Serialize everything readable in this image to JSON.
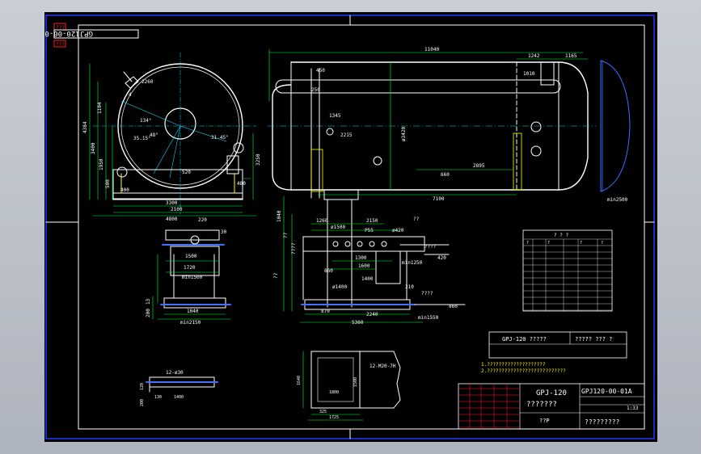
{
  "drawing": {
    "title_block": {
      "drawing_number": "GPJ120-00-01A",
      "model": "GPJ-120",
      "name": "???????",
      "scale": "1:33",
      "sub_label": "??P",
      "company": "?????????"
    },
    "side_tag": "GPJ120-00-01A",
    "red_tag_top": "???",
    "red_tag_bottom": "???",
    "spec_box": {
      "model": "GPJ-120 ?????",
      "code": "????? ??? ?"
    },
    "notes": [
      "1.????????????????????",
      "2.???????????????????????????"
    ],
    "table_header": "? ? ?",
    "table_col_headers": [
      "?",
      "?",
      "?",
      "?"
    ],
    "front_view": {
      "dims": [
        "2260",
        "4",
        "1104",
        "3400",
        "4384",
        "1950",
        "500",
        "520",
        "3300",
        "400",
        "3250",
        "480",
        "2100",
        "4800",
        "220",
        "30"
      ],
      "angles": [
        "134°",
        "48°",
        "35.15°",
        "31.45°"
      ]
    },
    "main_view": {
      "dims": [
        "11040",
        "1242",
        "1165",
        "450",
        "250",
        "1345",
        "2215",
        "1010",
        "2895",
        "660",
        "7100",
        "ø3420",
        "min2500"
      ]
    },
    "support_view": {
      "dims": [
        "1500",
        "1720",
        "min1500",
        "1040",
        "min2150",
        "200",
        "13"
      ]
    },
    "piping_view": {
      "dims": [
        "1040",
        "2150",
        "1260",
        "ø1500",
        "P55",
        "ø420",
        "min1250",
        "1300",
        "1600",
        "860",
        "ø1400",
        "1400",
        "210",
        "870",
        "2240",
        "5360",
        "min1550",
        "420",
        "860"
      ],
      "labels": [
        "??",
        "??",
        "????",
        "??",
        "????",
        "????"
      ]
    },
    "detail_a": {
      "label": "12-ø30",
      "dims": [
        "120",
        "130",
        "200",
        "1400"
      ]
    },
    "detail_b": {
      "label": "12-M20-7H",
      "dims": [
        "1640",
        "1500",
        "1800",
        "325",
        "1725"
      ]
    }
  }
}
